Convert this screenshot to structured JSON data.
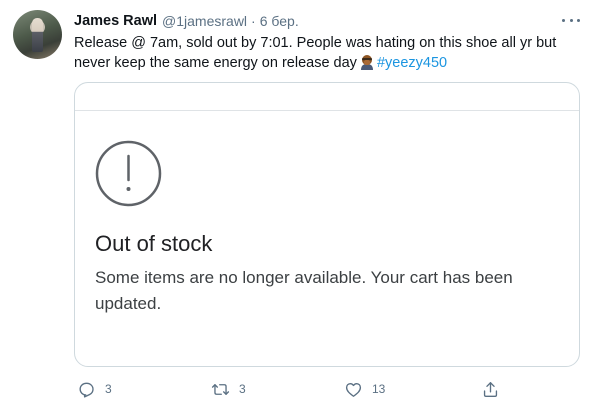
{
  "tweet": {
    "author_name": "James Rawl",
    "author_handle": "@1jamesrawl",
    "separator": "·",
    "timestamp": "6 бер.",
    "text_line1": "Release @ 7am, sold out by 7:01. People was hating on this shoe all yr but",
    "text_line2_prefix": "never keep the same energy on release day",
    "emoji": "facepalm-emoji",
    "hashtag": "#yeezy450"
  },
  "embedded_card": {
    "icon": "alert-circle-icon",
    "title": "Out of stock",
    "message": "Some items are no longer available. Your cart has been updated."
  },
  "actions": {
    "reply_count": "3",
    "retweet_count": "3",
    "like_count": "13"
  },
  "colors": {
    "secondary_text": "#5b7083",
    "hashtag": "#1b95e0",
    "border": "#cfd9de"
  }
}
